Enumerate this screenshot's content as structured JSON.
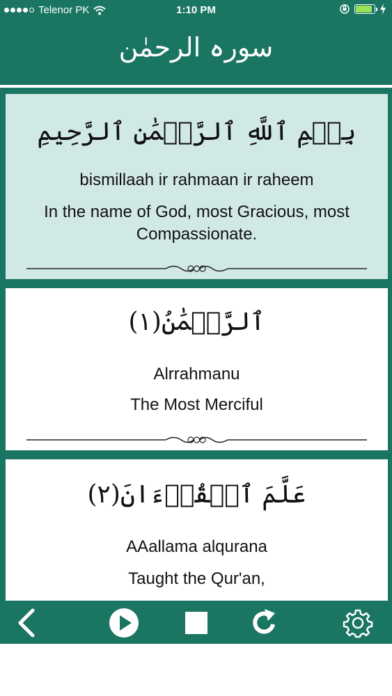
{
  "status_bar": {
    "carrier": "Telenor PK",
    "time": "1:10 PM",
    "battery_percent": 90
  },
  "header": {
    "title": "سورہ الرحمٰن"
  },
  "verses": [
    {
      "arabic": "بِسۡمِ ٱللَّهِ ٱلرَّحۡمَٰنِ ٱلرَّحِيمِ",
      "transliteration": "bismillaah ir rahmaan ir raheem",
      "translation": "In the name of God, most Gracious, most Compassionate."
    },
    {
      "arabic": "ٱلرَّحۡمَٰنُ(١)",
      "transliteration": "Alrrahmanu",
      "translation": "The Most Merciful"
    },
    {
      "arabic": "عَلَّمَ ٱلۡقُرۡءَانَ(٢)",
      "transliteration": "AAallama alqurana",
      "translation": "Taught the Qur'an,"
    }
  ],
  "toolbar": {
    "icons": [
      "chevron-left-icon",
      "play-icon",
      "stop-icon",
      "repeat-icon",
      "gear-icon"
    ]
  },
  "colors": {
    "primary": "#1a7562",
    "highlight_card": "#d1e9e5",
    "card": "#ffffff",
    "text": "#111111",
    "battery": "#9be15d"
  }
}
